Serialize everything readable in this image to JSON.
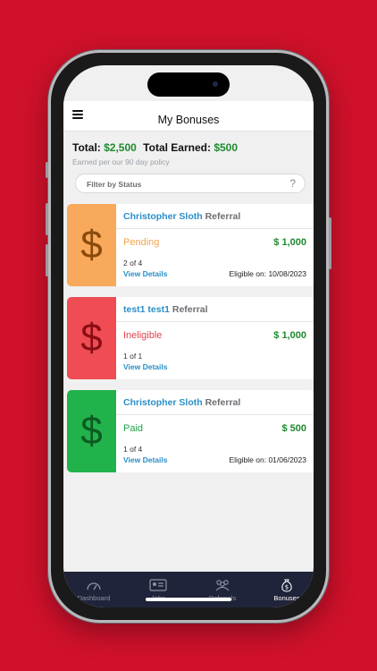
{
  "header": {
    "title": "My Bonuses"
  },
  "totals": {
    "total_label": "Total:",
    "total_value": "$2,500",
    "earned_label": "Total Earned:",
    "earned_value": "$500",
    "policy_note": "Earned per our 90 day policy"
  },
  "filter": {
    "placeholder": "Filter by Status",
    "help_icon": "?"
  },
  "bonuses": [
    {
      "name": "Christopher Sloth",
      "type": "Referral",
      "status": "Pending",
      "status_color": "#f0a44a",
      "side_color": "#f9a95b",
      "dollar_color": "#8a4a0c",
      "amount": "$ 1,000",
      "count": "2 of 4",
      "view_label": "View Details",
      "eligible": "Eligible on: 10/08/2023"
    },
    {
      "name": "test1 test1",
      "type": "Referral",
      "status": "Ineligible",
      "status_color": "#e0444e",
      "side_color": "#ef4d53",
      "dollar_color": "#8a0d14",
      "amount": "$ 1,000",
      "count": "1 of 1",
      "view_label": "View Details",
      "eligible": ""
    },
    {
      "name": "Christopher Sloth",
      "type": "Referral",
      "status": "Paid",
      "status_color": "#1fa34a",
      "side_color": "#22b24c",
      "dollar_color": "#0c5a22",
      "amount": "$ 500",
      "count": "1 of 4",
      "view_label": "View Details",
      "eligible": "Eligible on: 01/06/2023"
    }
  ],
  "dollar_symbol": "$",
  "tabs": [
    {
      "label": "Dashboard",
      "icon": "gauge-icon",
      "active": false
    },
    {
      "label": "Jobs",
      "icon": "id-card-icon",
      "active": false
    },
    {
      "label": "Referrals",
      "icon": "people-icon",
      "active": false
    },
    {
      "label": "Bonuses",
      "icon": "money-bag-icon",
      "active": true
    }
  ]
}
